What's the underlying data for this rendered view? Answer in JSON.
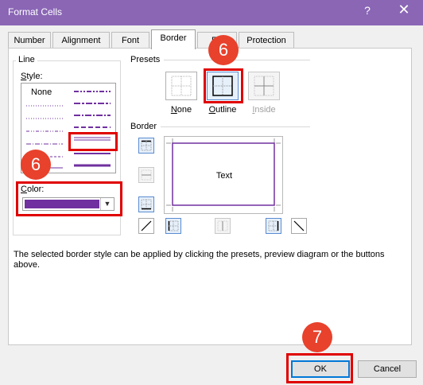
{
  "window": {
    "title": "Format Cells",
    "help": "?",
    "close": "✕"
  },
  "tabs": [
    {
      "label": "Number"
    },
    {
      "label": "Alignment"
    },
    {
      "label": "Font"
    },
    {
      "label": "Border",
      "active": true
    },
    {
      "label": "Fill"
    },
    {
      "label": "Protection"
    }
  ],
  "line": {
    "group_label": "Line",
    "style_label": "Style:",
    "style_none": "None",
    "color_label": "Color:",
    "color_value": "#7030a0",
    "color_dropdown_icon": "chevron-down-icon"
  },
  "presets": {
    "group_label": "Presets",
    "items": [
      {
        "label": "None",
        "icon": "border-none-icon",
        "disabled": false
      },
      {
        "label": "Outline",
        "icon": "border-outline-icon",
        "disabled": false,
        "selected": true
      },
      {
        "label": "Inside",
        "icon": "border-inside-icon",
        "disabled": true
      }
    ]
  },
  "border": {
    "group_label": "Border",
    "preview_text": "Text",
    "buttons": [
      {
        "name": "border-top-button",
        "state": "on"
      },
      {
        "name": "border-inside-horizontal-button",
        "state": "disabled"
      },
      {
        "name": "border-bottom-button",
        "state": "on"
      },
      {
        "name": "border-diagonal-up-button",
        "state": "off"
      },
      {
        "name": "border-left-button",
        "state": "on"
      },
      {
        "name": "border-inside-vertical-button",
        "state": "disabled"
      },
      {
        "name": "border-right-button",
        "state": "on"
      },
      {
        "name": "border-diagonal-down-button",
        "state": "off"
      }
    ]
  },
  "description": "The selected border style can be applied by clicking the presets, preview diagram or the buttons above.",
  "footer": {
    "ok": "OK",
    "cancel": "Cancel"
  },
  "annotations": [
    {
      "label": "6"
    },
    {
      "label": "6"
    },
    {
      "label": "7"
    }
  ],
  "colors": {
    "title_bar": "#8a66b5",
    "accent": "#7030a0",
    "highlight": "#e00000",
    "badge": "#e8412c"
  }
}
